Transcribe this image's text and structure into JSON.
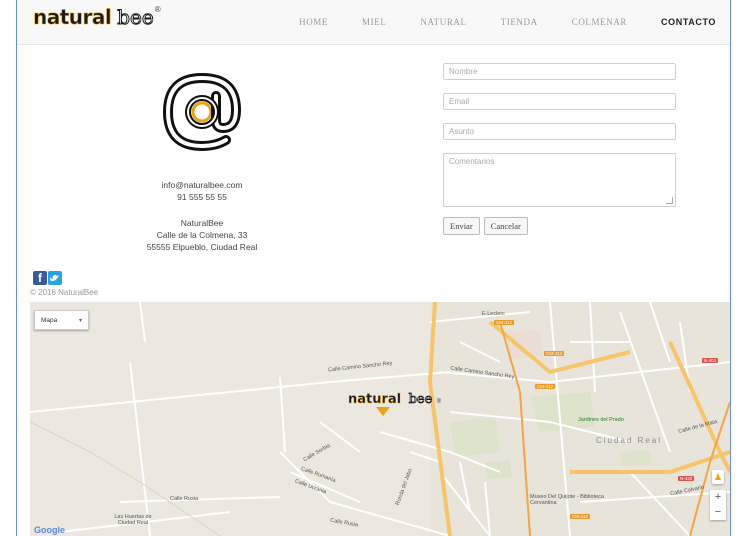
{
  "nav": {
    "logo": {
      "word1": "natural",
      "word2": "bee",
      "mark": "®"
    },
    "items": [
      {
        "label": "HOME",
        "active": false
      },
      {
        "label": "MIEL",
        "active": false
      },
      {
        "label": "NATURAL",
        "active": false
      },
      {
        "label": "TIENDA",
        "active": false
      },
      {
        "label": "COLMENAR",
        "active": false
      },
      {
        "label": "CONTACTO",
        "active": true
      }
    ]
  },
  "contact": {
    "icon": "at-sign-icon",
    "email": "info@naturalbee.com",
    "phone": "91 555 55 55",
    "company": "NaturalBee",
    "address1": "Calle de la Colmena, 33",
    "address2": "55555 Elpueblo, Ciudad Real"
  },
  "form": {
    "name_placeholder": "Nombre",
    "email_placeholder": "Email",
    "subject_placeholder": "Asunto",
    "comments_placeholder": "Comentarios",
    "send_label": "Enviar",
    "cancel_label": "Cancelar"
  },
  "social": {
    "facebook": "f",
    "twitter": "t"
  },
  "footer": {
    "copyright": "© 2016 NaturalBee"
  },
  "map": {
    "type_label": "Mapa",
    "zoom_in": "+",
    "zoom_out": "−",
    "google": "Google",
    "marker": {
      "word1": "natural",
      "word2": "bee",
      "mark": "®"
    },
    "labels": {
      "city": "Ciudad Real",
      "park": "Jardines del Prado",
      "museum": "Museo Del Quijote - Biblioteca Cervantina",
      "eleclerc": "E.Leclerc",
      "sancho1": "Calle Camino Sancho Rey",
      "sancho2": "Calle Camino Sancho Rey",
      "rusia1": "Calle Rusia",
      "rusia2": "Calle Rusia",
      "serbia": "Calle Serbia",
      "rumania": "Calle Rumanía",
      "ucrania": "Calle Ucrania",
      "huertas": "Las Huertas de Ciudad Real",
      "ronda": "Ronda del Jabo",
      "calvario": "Calle Calvario",
      "mata": "Calle de la Mata",
      "cm412a": "CM-412",
      "cm412b": "CM-412",
      "cm412c": "CM-412",
      "cm412d": "CM-412",
      "n401": "N-401",
      "n420": "N-420"
    }
  },
  "colors": {
    "brand": "#e8a317",
    "nav_bg": "#f8f8f8",
    "map_bg": "#ece8df"
  }
}
